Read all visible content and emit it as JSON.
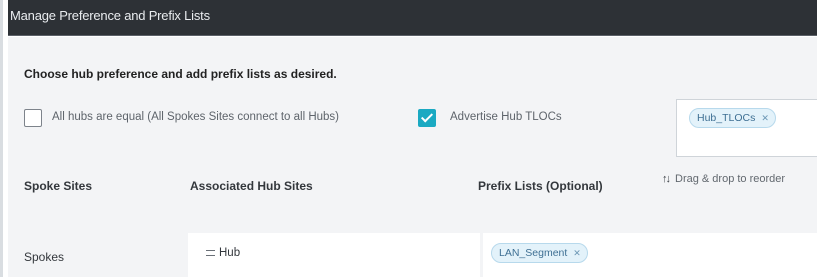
{
  "dialog": {
    "title": "Manage Preference and Prefix Lists"
  },
  "instruction": "Choose hub preference and add prefix lists as desired.",
  "options": {
    "all_hubs_equal": {
      "label": "All hubs are equal (All Spokes Sites connect to all Hubs)",
      "checked": false
    },
    "advertise_hub_tlocs": {
      "label": "Advertise Hub TLOCs",
      "checked": true
    }
  },
  "tloc_tags": [
    "Hub_TLOCs"
  ],
  "table": {
    "headers": {
      "spoke_sites": "Spoke Sites",
      "associated_hub_sites": "Associated Hub Sites",
      "prefix_lists": "Prefix Lists (Optional)"
    },
    "drag_hint": "Drag & drop to reorder",
    "rows": [
      {
        "spoke": "Spokes",
        "hub": "Hub",
        "prefix_tags": [
          "LAN_Segment"
        ]
      }
    ]
  },
  "colors": {
    "title_bar": "#2d3136",
    "content_bg": "#f3f4f6",
    "checkbox_checked": "#1aa9c2",
    "chip_bg": "#e3f2fa",
    "chip_text": "#3e6f93"
  },
  "icons": {
    "chip_remove": "close-icon",
    "checkbox_mark": "check-icon",
    "reorder": "sort-arrows-icon",
    "drag_handle": "grip-icon"
  }
}
